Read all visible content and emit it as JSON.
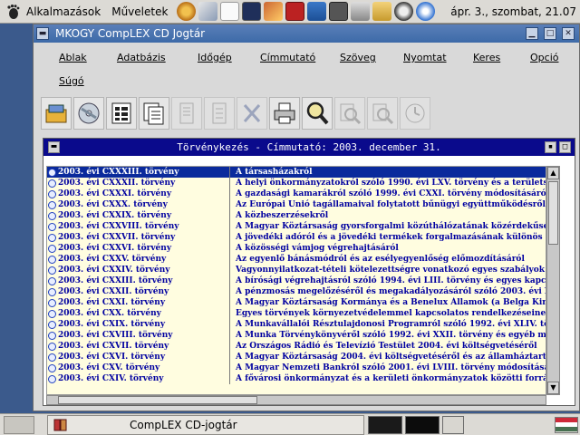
{
  "top_panel": {
    "applications_label": "Alkalmazások",
    "actions_label": "Műveletek",
    "clock": "ápr.  3., szombat, 21.07"
  },
  "window": {
    "title": "MKOGY CompLEX CD Jogtár"
  },
  "menu": {
    "ablak": "Ablak",
    "adatbazis": "Adatbázis",
    "idogep": "Időgép",
    "cimmutato": "Címmutató",
    "szoveg": "Szöveg",
    "nyomtat": "Nyomtat",
    "keres": "Keres",
    "opcio": "Opció",
    "sugo": "Súgó"
  },
  "toolbar": {
    "buttons": [
      "open-db-icon",
      "cd-icon",
      "toc-icon",
      "documents-icon",
      "doc-gray-icon",
      "doc-gray-2-icon",
      "cut-icon",
      "print-icon",
      "search-icon",
      "zoom-gray-icon",
      "zoom-gray-2-icon",
      "timeline-icon"
    ]
  },
  "inner_window": {
    "title": "Törvénykezés - Címmutató: 2003. december 31."
  },
  "list": {
    "rows": [
      {
        "law": "2003. évi CXXXIII. törvény",
        "title": "A társasházakról"
      },
      {
        "law": "2003. évi CXXXII. törvény",
        "title": "A helyi önkormányzatokról szóló 1990. évi LXV. törvény és a területszervezési"
      },
      {
        "law": "2003. évi CXXXI. törvény",
        "title": "A gazdasági kamarákról szóló 1999. évi CXXI. törvény módosításáról"
      },
      {
        "law": "2003. évi CXXX. törvény",
        "title": "Az Európai Unió tagállamaival folytatott bűnügyi együttműködésről"
      },
      {
        "law": "2003. évi CXXIX. törvény",
        "title": "A közbeszerzésekről"
      },
      {
        "law": "2003. évi CXXVIII. törvény",
        "title": "A Magyar Köztársaság gyorsforgalmi közúthálózatának közérdekűségéről és fe"
      },
      {
        "law": "2003. évi CXXVII. törvény",
        "title": "A jövedéki adóról és a jövedéki termékek forgalmazásának különös szabályair"
      },
      {
        "law": "2003. évi CXXVI. törvény",
        "title": "A közösségi vámjog végrehajtásáról"
      },
      {
        "law": "2003. évi CXXV. törvény",
        "title": "Az egyenlő bánásmódról és az esélyegyenlőség előmozdításáról"
      },
      {
        "law": "2003. évi CXXIV. törvény",
        "title": "Vagyonnyilatkozat-tételi kötelezettségre vonatkozó egyes szabályok módosítá"
      },
      {
        "law": "2003. évi CXXIII. törvény",
        "title": "A bírósági végrehajtásról szóló 1994. évi LIII. törvény és egyes kapcsolódó jog"
      },
      {
        "law": "2003. évi CXXII. törvény",
        "title": "A pénzmosás megelőzéséről és megakadályozásáról szóló 2003. évi XV. törvény"
      },
      {
        "law": "2003. évi CXXI. törvény",
        "title": "A Magyar Köztársaság Kormánya és a Benelux Államok (a Belga Királyság, a L"
      },
      {
        "law": "2003. évi CXX. törvény",
        "title": "Egyes törvények környezetvédelemmel kapcsolatos rendelkezéseinek módosítá"
      },
      {
        "law": "2003. évi CXIX. törvény",
        "title": "A Munkavállalói Résztulajdonosi Programról szóló 1992. évi XLIV. törvény m"
      },
      {
        "law": "2003. évi CXVIII. törvény",
        "title": "A Munka Törvénykönyvéről szóló 1992. évi XXII. törvény és egyéb munkajogi"
      },
      {
        "law": "2003. évi CXVII. törvény",
        "title": "Az Országos Rádió és Televízió Testület 2004. évi költségvetéséről"
      },
      {
        "law": "2003. évi CXVI. törvény",
        "title": "A Magyar Köztársaság 2004. évi költségvetéséről és az államháztartás hároméve"
      },
      {
        "law": "2003. évi CXV. törvény",
        "title": "A Magyar Nemzeti Bankról szóló 2001. évi LVIII. törvény módosításáról"
      },
      {
        "law": "2003. évi CXIV. törvény",
        "title": "A fővárosi önkormányzat és a kerületi önkormányzatok közötti forrásmegoszta"
      }
    ]
  },
  "taskbar": {
    "task_label": "CompLEX CD-jogtár"
  },
  "colors": {
    "list_bg": "#fffde0",
    "list_text": "#0000a0",
    "selection": "#0a2a9c",
    "inner_title_bg": "#0a0a8c"
  }
}
